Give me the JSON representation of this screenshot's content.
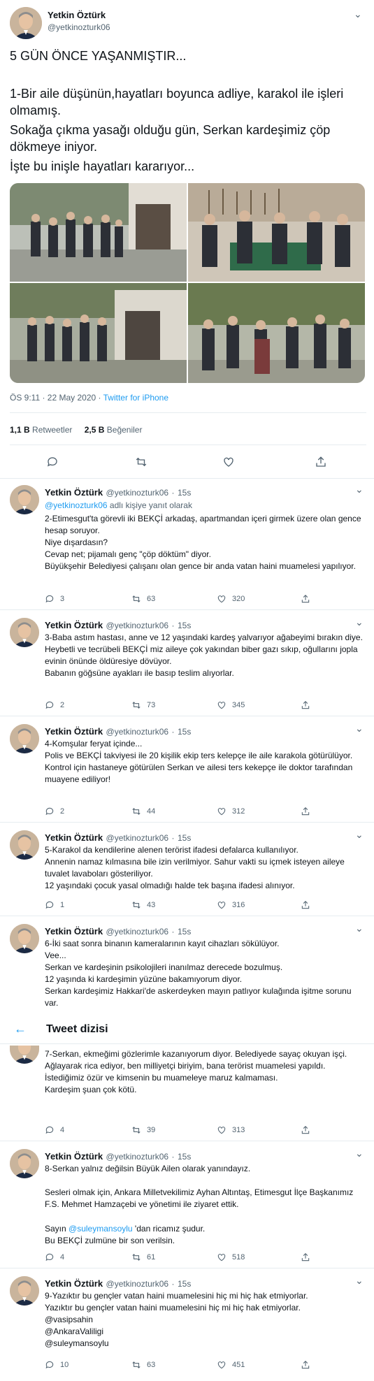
{
  "main_tweet": {
    "name": "Yetkin Öztürk",
    "handle": "@yetkinozturk06",
    "headline": "5 GÜN ÖNCE YAŞANMIŞTIR...",
    "paragraph_1": "1-Bir aile düşünün,hayatları boyunca adliye, karakol ile işleri olmamış.",
    "paragraph_2": "Sokağa çıkma yasağı olduğu gün, Serkan kardeşimiz çöp dökmeye iniyor.",
    "paragraph_3": "İşte bu inişle hayatları kararıyor...",
    "time": "ÖS 9:11 · 22 May 2020",
    "separator": " · ",
    "source": "Twitter for iPhone",
    "retweets_count": "1,1 B",
    "retweets_label": "Retweetler",
    "likes_count": "2,5 B",
    "likes_label": "Beğeniler"
  },
  "replies": [
    {
      "name": "Yetkin Öztürk",
      "handle": "@yetkinozturk06",
      "age": "15s",
      "reply_to_handle": "@yetkinozturk06",
      "reply_to_suffix": " adlı kişiye yanıt olarak",
      "text": "2-Etimesgut'ta görevli iki BEKÇİ arkadaş, apartmandan içeri girmek üzere olan gence hesap soruyor.\nNiye dışardasın?\nCevap net; pijamalı genç \"çöp döktüm\" diyor.\nBüyükşehir Belediyesi çalışanı olan gence bir anda vatan haini muamelesi yapılıyor.",
      "replies": "3",
      "retweets": "63",
      "likes": "320"
    },
    {
      "name": "Yetkin Öztürk",
      "handle": "@yetkinozturk06",
      "age": "15s",
      "text": "3-Baba astım hastası, anne ve 12 yaşındaki kardeş yalvarıyor ağabeyimi bırakın diye.\nHeybetli ve tecrübeli BEKÇİ miz aileye çok yakından biber gazı sıkıp, oğullarını jopla evinin önünde öldüresiye dövüyor.\nBabanın göğsüne ayakları ile basıp teslim alıyorlar.",
      "replies": "2",
      "retweets": "73",
      "likes": "345"
    },
    {
      "name": "Yetkin Öztürk",
      "handle": "@yetkinozturk06",
      "age": "15s",
      "text": "4-Komşular feryat içinde...\nPolis ve BEKÇİ takviyesi ile 20 kişilik ekip ters kelepçe ile aile karakola götürülüyor.\nKontrol için hastaneye götürülen Serkan ve ailesi ters kekepçe ile doktor tarafından muayene ediliyor!",
      "replies": "2",
      "retweets": "44",
      "likes": "312"
    },
    {
      "name": "Yetkin Öztürk",
      "handle": "@yetkinozturk06",
      "age": "15s",
      "text": "5-Karakol da kendilerine alenen terörist ifadesi defalarca kullanılıyor.\nAnnenin namaz kılmasına bile izin verilmiyor. Sahur vakti su içmek isteyen aileye tuvalet lavaboları gösteriliyor.\n12 yaşındaki çocuk yasal olmadığı halde tek başına ifadesi alınıyor.",
      "replies": "1",
      "retweets": "43",
      "likes": "316"
    },
    {
      "name": "Yetkin Öztürk",
      "handle": "@yetkinozturk06",
      "age": "15s",
      "text": "6-İki saat sonra binanın kameralarının kayıt cihazları sökülüyor.\nVee...\nSerkan ve kardeşinin psikolojileri inanılmaz derecede bozulmuş.\n12 yaşında ki kardeşimin yüzüne bakamıyorum diyor.\nSerkan kardeşimiz Hakkari'de askerdeyken mayın patlıyor kulağında işitme sorunu var."
    },
    {
      "text": "7-Serkan, ekmeğimi gözlerimle kazanıyorum diyor. Belediyede sayaç okuyan işçi.\nAğlayarak rica ediyor, ben milliyetçi biriyim, bana terörist muamelesi yapıldı. İstediğimiz özür ve kimsenin bu muameleye maruz kalmaması.\nKardeşim şuan çok kötü.",
      "replies": "4",
      "retweets": "39",
      "likes": "313"
    },
    {
      "name": "Yetkin Öztürk",
      "handle": "@yetkinozturk06",
      "age": "15s",
      "text_1": "8-Serkan yalnız değilsin Büyük Ailen olarak yanındayız.",
      "text_2": "Sesleri olmak için, Ankara Milletvekilimiz Ayhan Altıntaş, Etimesgut İlçe Başkanımız F.S. Mehmet Hamzaçebi ve yönetimi ile ziyaret ettik.",
      "text_3_prefix": "Sayın ",
      "text_3_mention": "@suleymansoylu",
      "text_3_suffix": " 'dan ricamız şudur.",
      "text_4": "Bu BEKÇİ zulmüne bir son verilsin.",
      "replies": "4",
      "retweets": "61",
      "likes": "518"
    },
    {
      "name": "Yetkin Öztürk",
      "handle": "@yetkinozturk06",
      "age": "15s",
      "text": "9-Yazıktır bu gençler vatan haini muamelesini hiç mi hiç hak etmiyorlar.\nYazıktır bu gençler vatan haini muamelesini hiç mi hiç hak etmiyorlar.",
      "mentions": [
        "@vasipsahin",
        "@AnkaraValiligi",
        "@suleymansoylu"
      ],
      "replies": "10",
      "retweets": "63",
      "likes": "451"
    }
  ],
  "thread_header": {
    "back_icon": "arrow-left-icon",
    "title": "Tweet dizisi"
  },
  "colors": {
    "accent": "#1d9bf0",
    "text": "#0f1419",
    "secondary": "#536471",
    "divider": "#e6ecf0"
  }
}
